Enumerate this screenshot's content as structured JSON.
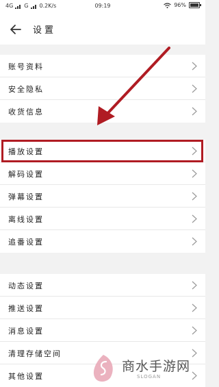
{
  "status_bar": {
    "network_1": "4G",
    "network_2": "G",
    "speed": "0.2K/s",
    "time": "09:19",
    "battery": "96%",
    "battery_level_fraction": 0.96
  },
  "header": {
    "title": "设置",
    "back_icon": "arrow-left-icon"
  },
  "groups": [
    {
      "items": [
        {
          "label": "账号资料"
        },
        {
          "label": "安全隐私"
        },
        {
          "label": "收货信息"
        }
      ]
    },
    {
      "items": [
        {
          "label": "播放设置"
        },
        {
          "label": "解码设置"
        },
        {
          "label": "弹幕设置"
        },
        {
          "label": "离线设置"
        },
        {
          "label": "追番设置"
        }
      ]
    },
    {
      "items": [
        {
          "label": "动态设置"
        },
        {
          "label": "推送设置"
        },
        {
          "label": "消息设置"
        },
        {
          "label": "清理存储空间"
        },
        {
          "label": "其他设置"
        }
      ]
    }
  ],
  "annotation": {
    "highlight_color": "#b01c23",
    "arrow_color": "#b01c23"
  },
  "watermark": {
    "text": "商水手游网",
    "slogan": "SLOGAN",
    "logo_color": "#e8a4b4"
  },
  "colors": {
    "background": "#f2f2f2",
    "chevron": "#999999"
  }
}
